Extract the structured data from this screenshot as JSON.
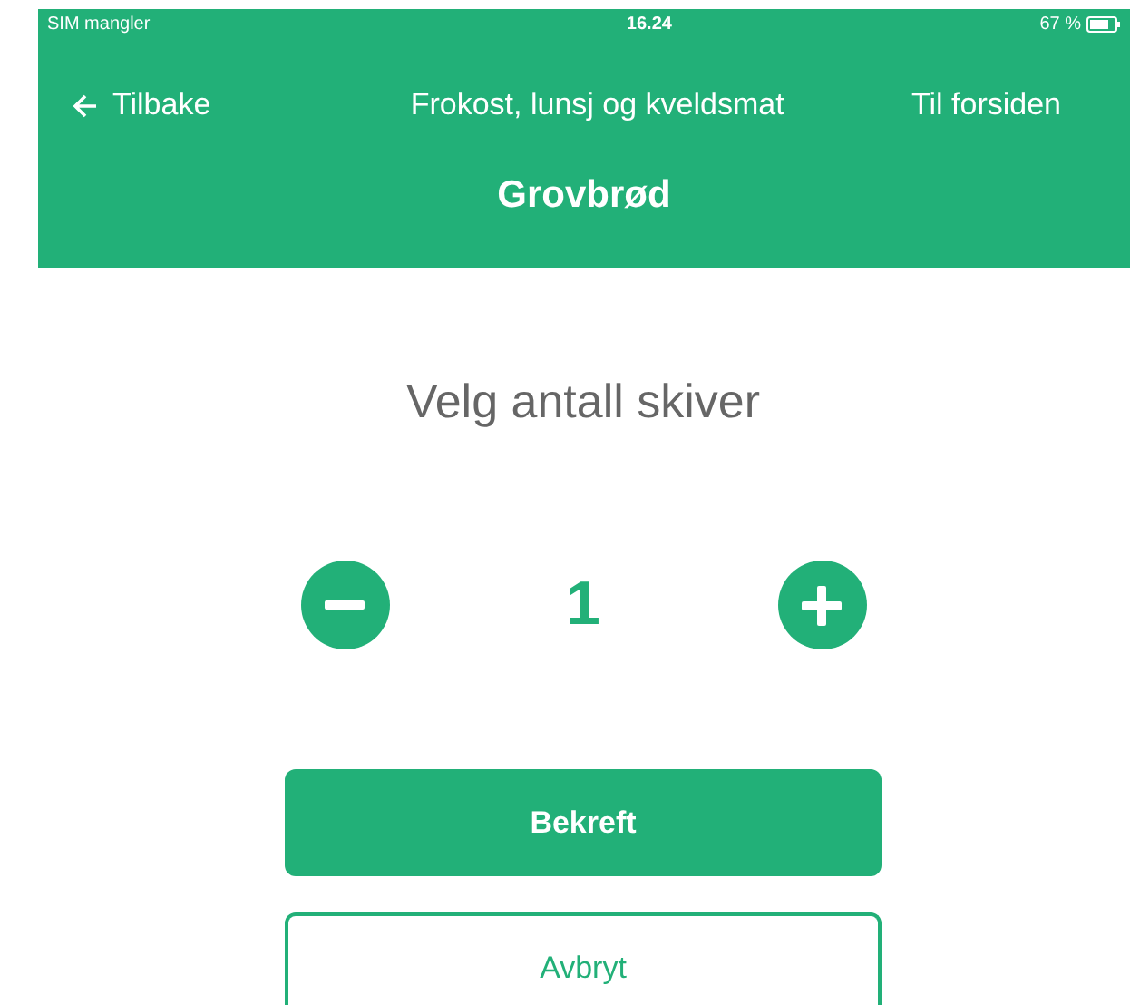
{
  "status_bar": {
    "carrier": "SIM mangler",
    "time": "16.24",
    "battery": "67 %"
  },
  "nav": {
    "back": "Tilbake",
    "category": "Frokost, lunsj og kveldsmat",
    "home": "Til forsiden",
    "title": "Grovbrød"
  },
  "prompt": "Velg antall skiver",
  "stepper": {
    "value": "1"
  },
  "buttons": [
    {
      "label": "Bekreft",
      "kind": "primary"
    },
    {
      "label": "Avbryt",
      "kind": "secondary"
    }
  ]
}
